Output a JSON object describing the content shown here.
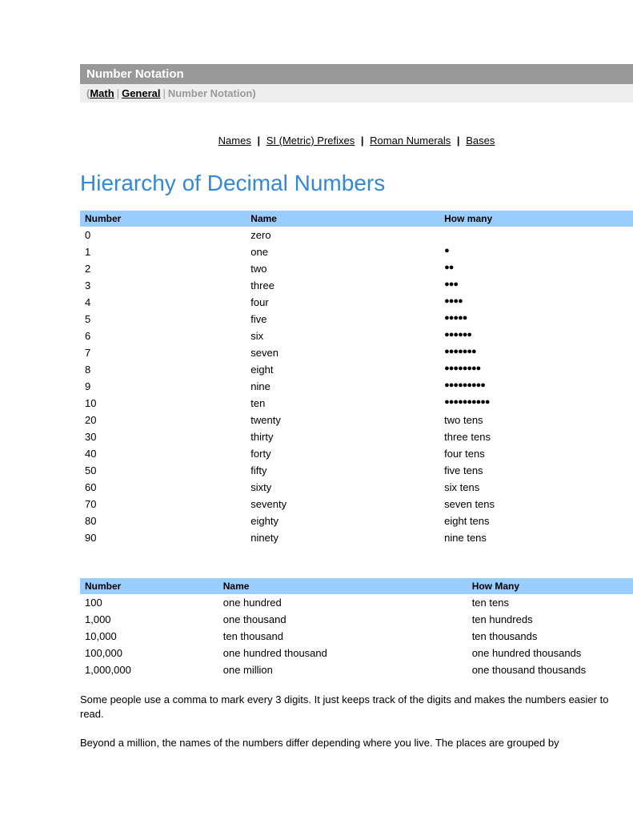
{
  "header": {
    "title": "Number Notation"
  },
  "breadcrumb": {
    "open": "(",
    "close": ")",
    "items": [
      {
        "label": "Math",
        "link": true
      },
      {
        "label": "General",
        "link": true
      },
      {
        "label": "Number Notation",
        "link": false
      }
    ],
    "sep": "|"
  },
  "nav": {
    "items": [
      "Names",
      "SI (Metric) Prefixes",
      "Roman Numerals",
      "Bases"
    ],
    "sep": "|"
  },
  "heading": "Hierarchy of Decimal Numbers",
  "table1": {
    "headers": [
      "Number",
      "Name",
      "How many"
    ],
    "rows": [
      {
        "number": "0",
        "name": "zero",
        "how": ""
      },
      {
        "number": "1",
        "name": "one",
        "how": "●"
      },
      {
        "number": "2",
        "name": "two",
        "how": "●●"
      },
      {
        "number": "3",
        "name": "three",
        "how": "●●●"
      },
      {
        "number": "4",
        "name": "four",
        "how": "●●●●"
      },
      {
        "number": "5",
        "name": "five",
        "how": "●●●●●"
      },
      {
        "number": "6",
        "name": "six",
        "how": "●●●●●●"
      },
      {
        "number": "7",
        "name": "seven",
        "how": "●●●●●●●"
      },
      {
        "number": "8",
        "name": "eight",
        "how": "●●●●●●●●"
      },
      {
        "number": "9",
        "name": "nine",
        "how": "●●●●●●●●●"
      },
      {
        "number": "10",
        "name": "ten",
        "how": "●●●●●●●●●●"
      },
      {
        "number": "20",
        "name": "twenty",
        "how": "two tens"
      },
      {
        "number": "30",
        "name": "thirty",
        "how": "three tens"
      },
      {
        "number": "40",
        "name": "forty",
        "how": "four tens"
      },
      {
        "number": "50",
        "name": "fifty",
        "how": "five tens"
      },
      {
        "number": "60",
        "name": "sixty",
        "how": "six tens"
      },
      {
        "number": "70",
        "name": "seventy",
        "how": "seven tens"
      },
      {
        "number": "80",
        "name": "eighty",
        "how": "eight tens"
      },
      {
        "number": "90",
        "name": "ninety",
        "how": "nine tens"
      }
    ]
  },
  "table2": {
    "headers": [
      "Number",
      "Name",
      "How Many"
    ],
    "rows": [
      {
        "number": "100",
        "name": "one hundred",
        "how": "ten tens"
      },
      {
        "number": "1,000",
        "name": "one thousand",
        "how": "ten hundreds"
      },
      {
        "number": "10,000",
        "name": "ten thousand",
        "how": "ten thousands"
      },
      {
        "number": "100,000",
        "name": "one hundred thousand",
        "how": "one hundred thousands"
      },
      {
        "number": "1,000,000",
        "name": "one million",
        "how": "one thousand thousands"
      }
    ]
  },
  "paragraphs": [
    "Some people use a comma to mark every 3 digits. It just keeps track of the digits and makes the numbers easier to read.",
    "Beyond a million, the names of the numbers differ depending where you live. The places are grouped by"
  ]
}
